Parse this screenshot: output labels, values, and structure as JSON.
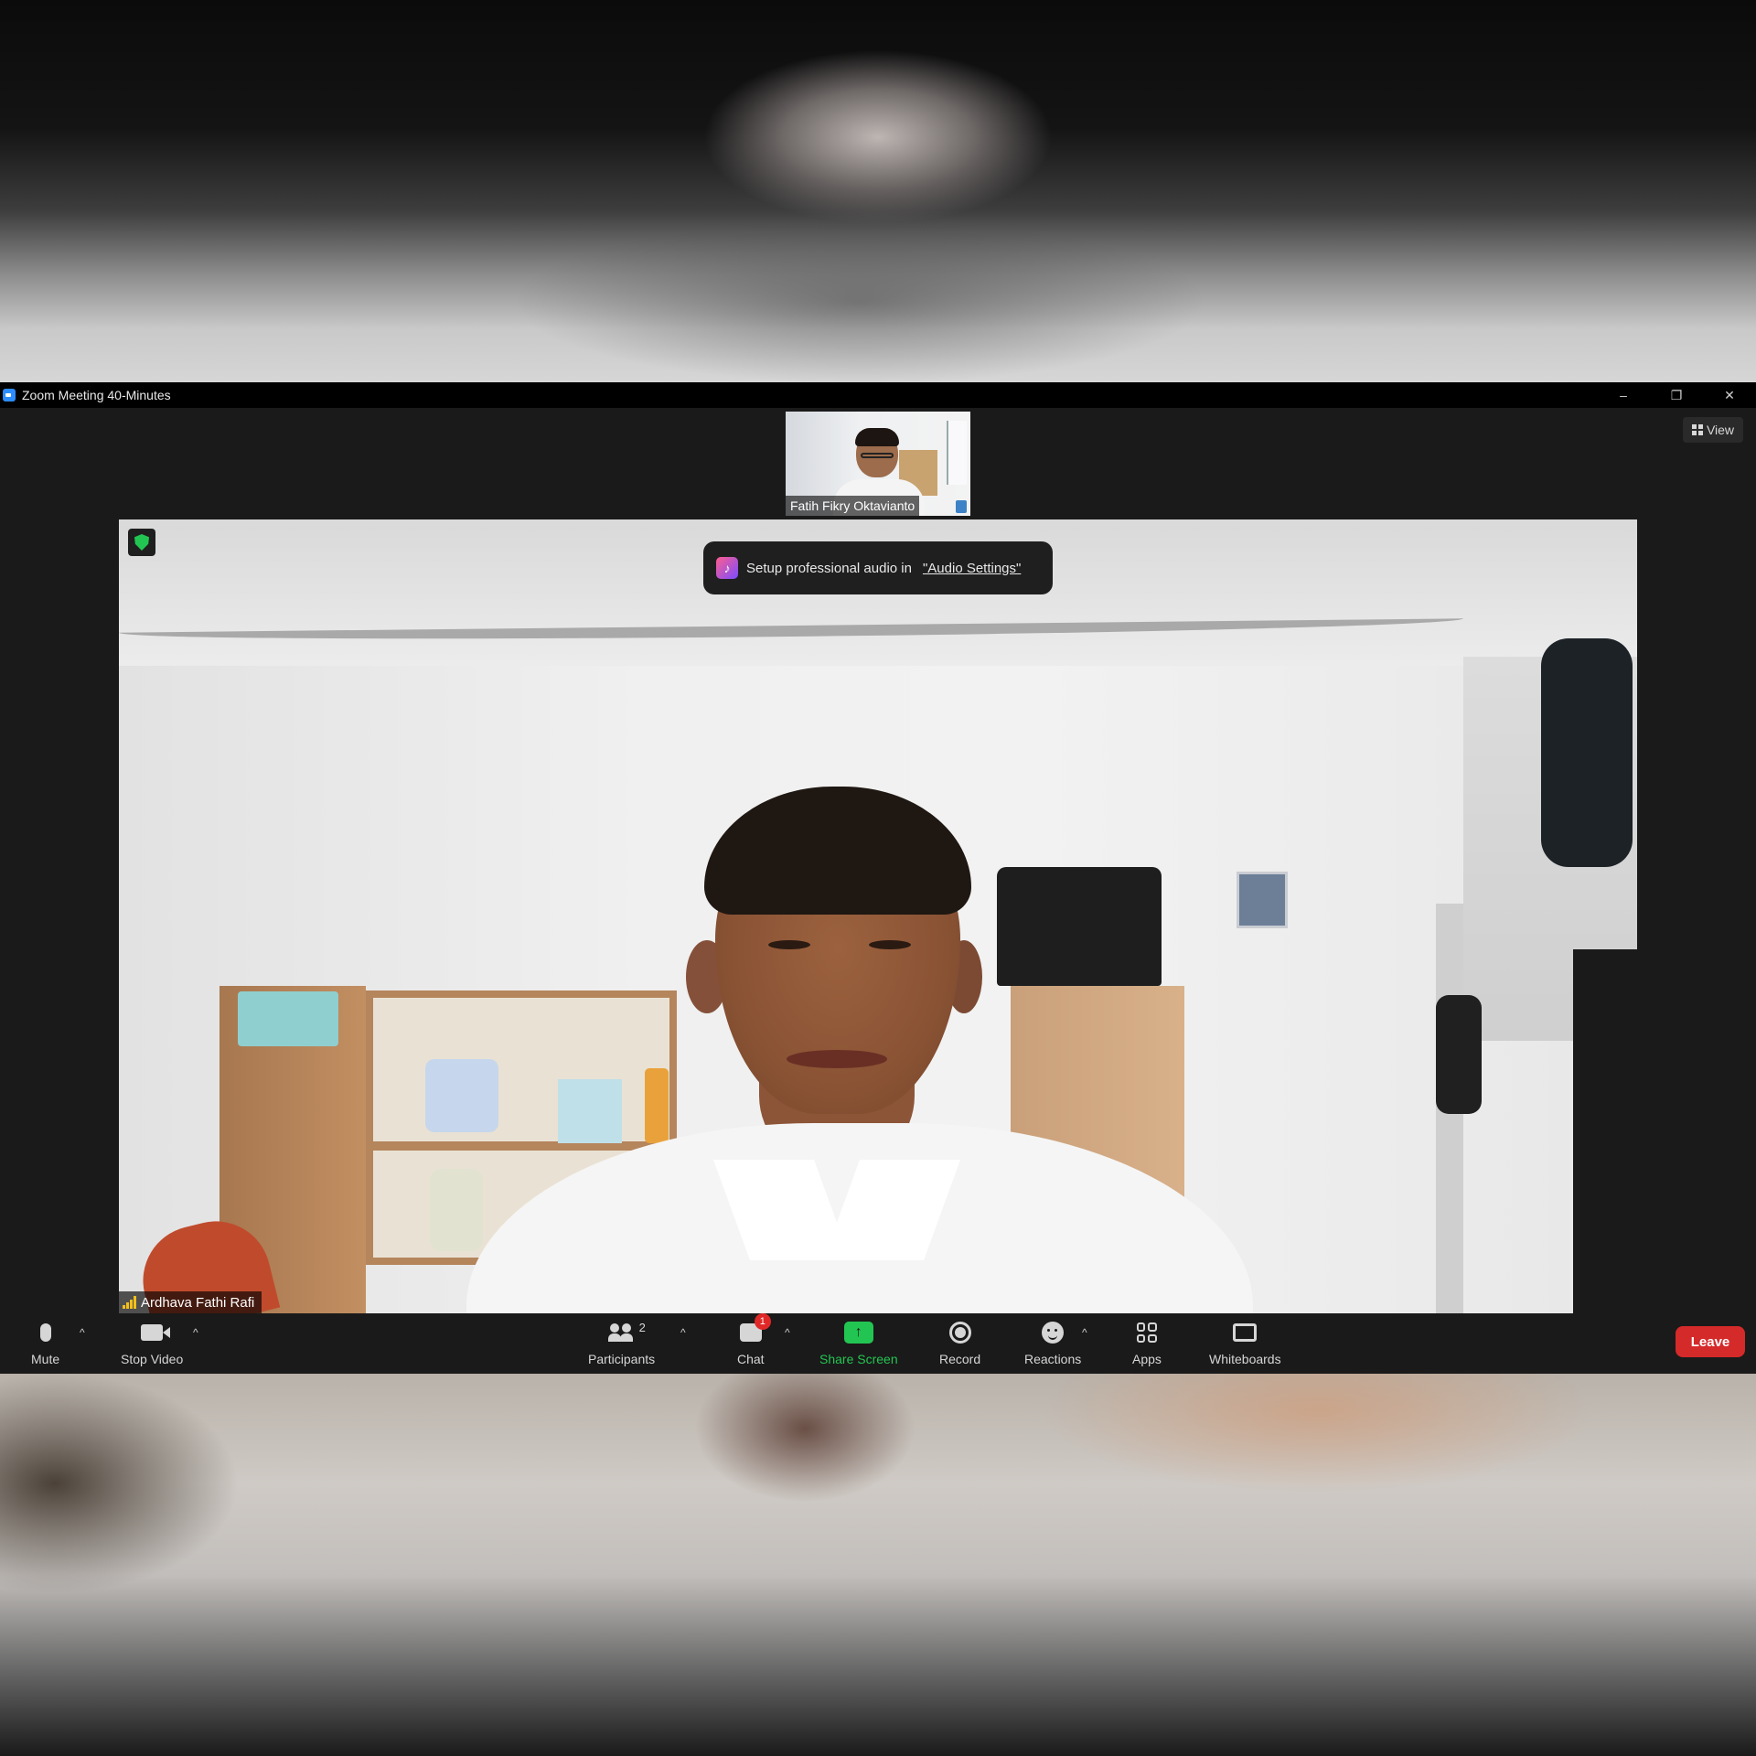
{
  "window": {
    "title": "Zoom Meeting 40-Minutes",
    "controls": {
      "minimize": "–",
      "restore": "❐",
      "close": "✕"
    }
  },
  "view_button": {
    "label": "View",
    "icon": "grid-icon"
  },
  "thumbnail": {
    "participant_name": "Fatih Fikry Oktavianto"
  },
  "main_video": {
    "participant_name": "Ardhava Fathi Rafi",
    "security_icon": "shield-check-icon",
    "notification": {
      "text": "Setup professional audio in",
      "link": "\"Audio Settings\"",
      "icon": "music-note-icon"
    }
  },
  "toolbar": {
    "mute": {
      "label": "Mute",
      "icon": "microphone-icon"
    },
    "stop_video": {
      "label": "Stop Video",
      "icon": "video-camera-icon"
    },
    "participants": {
      "label": "Participants",
      "count": "2",
      "icon": "people-icon"
    },
    "chat": {
      "label": "Chat",
      "badge": "1",
      "icon": "chat-icon"
    },
    "share_screen": {
      "label": "Share Screen",
      "icon": "share-arrow-icon",
      "color": "#23c552"
    },
    "record": {
      "label": "Record",
      "icon": "record-icon"
    },
    "reactions": {
      "label": "Reactions",
      "icon": "emoji-icon"
    },
    "apps": {
      "label": "Apps",
      "icon": "apps-icon"
    },
    "whiteboards": {
      "label": "Whiteboards",
      "icon": "whiteboard-icon"
    },
    "leave": {
      "label": "Leave",
      "color": "#d52a2a"
    },
    "caret": "^"
  },
  "colors": {
    "accent_green": "#23c552",
    "leave_red": "#d52a2a",
    "toolbar_bg": "#1a1a1a"
  }
}
